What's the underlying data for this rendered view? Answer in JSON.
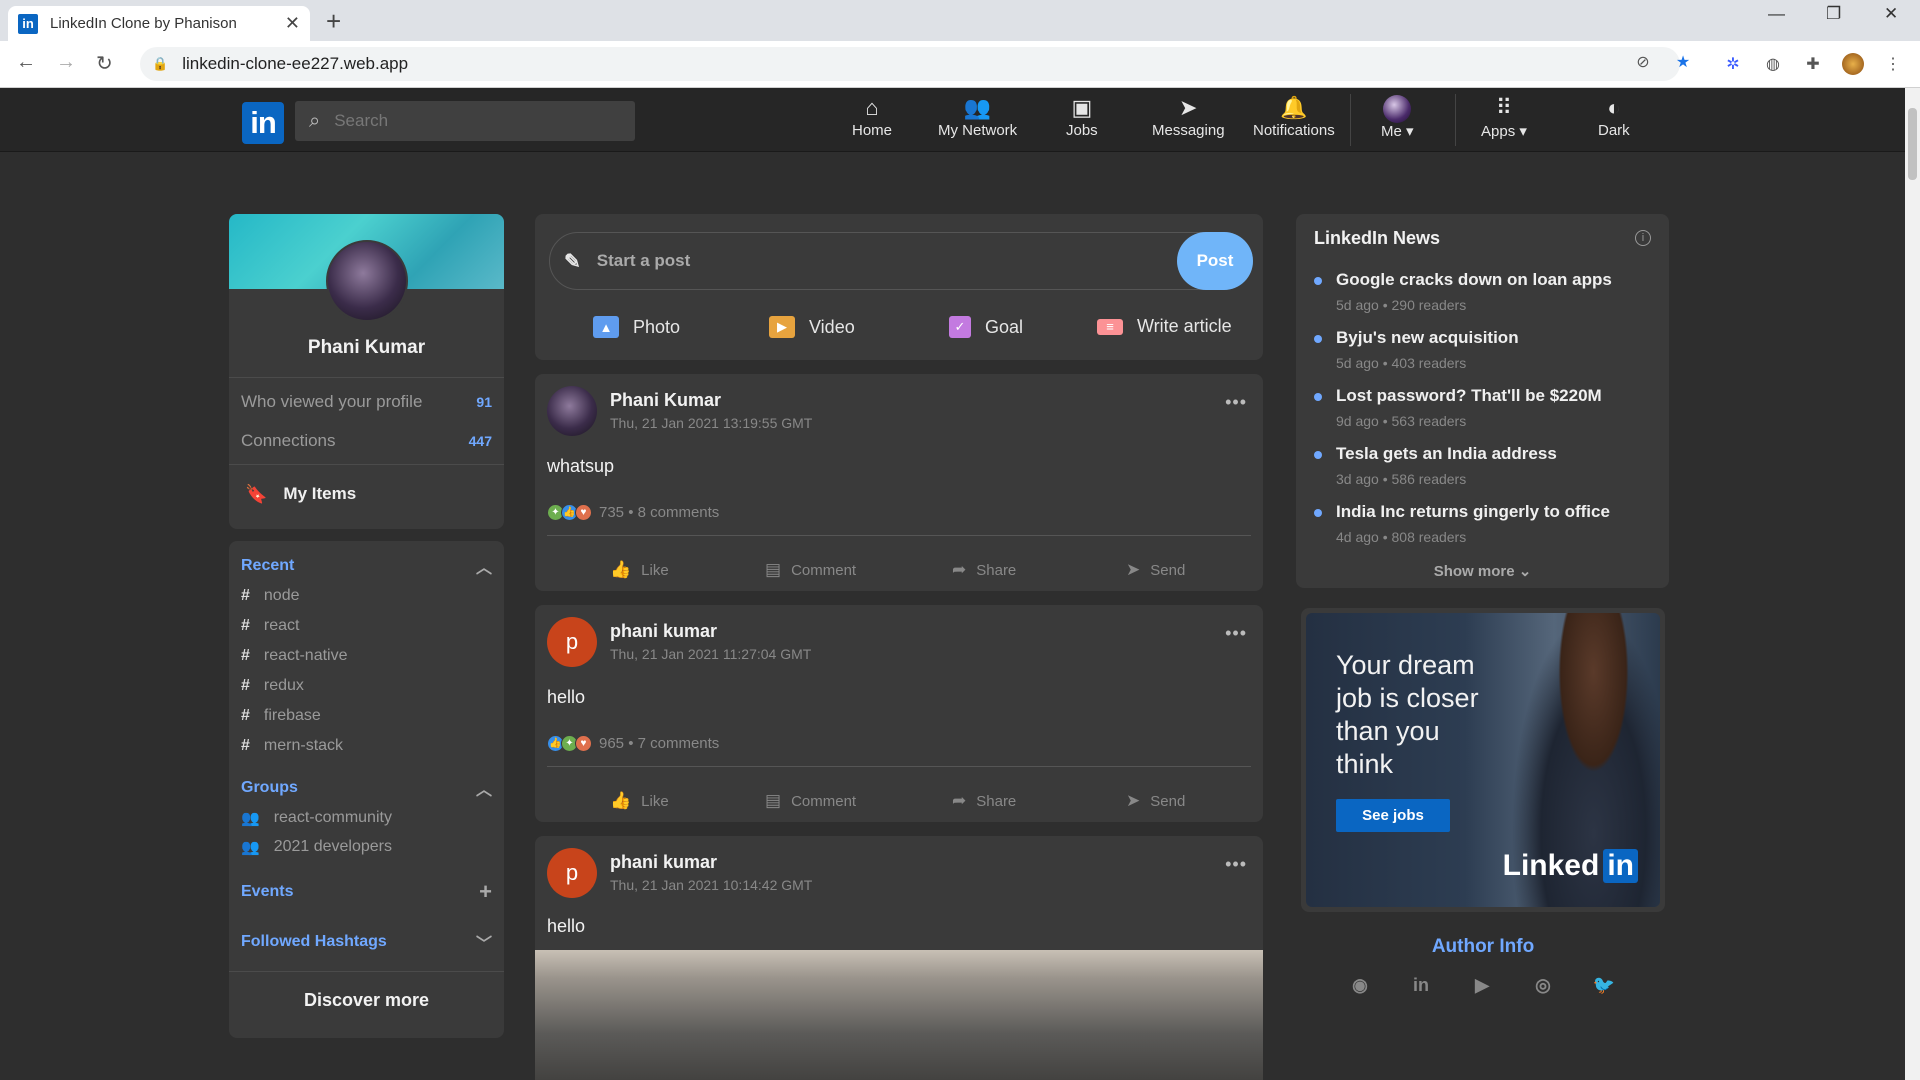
{
  "browser": {
    "tab_title": "LinkedIn Clone by Phanison",
    "tab_close": "✕",
    "new_tab": "+",
    "url": "linkedin-clone-ee227.web.app"
  },
  "header": {
    "logo": "in",
    "search_placeholder": "Search",
    "nav": [
      {
        "label": "Home",
        "icon": "home-icon"
      },
      {
        "label": "My Network",
        "icon": "network-icon"
      },
      {
        "label": "Jobs",
        "icon": "briefcase-icon"
      },
      {
        "label": "Messaging",
        "icon": "send-icon"
      },
      {
        "label": "Notifications",
        "icon": "bell-icon"
      },
      {
        "label": "Me ▾",
        "icon": "avatar"
      },
      {
        "label": "Apps ▾",
        "icon": "grid-icon"
      },
      {
        "label": "Dark",
        "icon": "theme-icon"
      }
    ]
  },
  "profile": {
    "name": "Phani Kumar",
    "viewed_label": "Who viewed your profile",
    "viewed_count": "91",
    "connections_label": "Connections",
    "connections_count": "447",
    "my_items": "My Items"
  },
  "sidebar": {
    "recent_label": "Recent",
    "recent_tags": [
      "node",
      "react",
      "react-native",
      "redux",
      "firebase",
      "mern-stack"
    ],
    "groups_label": "Groups",
    "groups": [
      "react-community",
      "2021 developers"
    ],
    "events_label": "Events",
    "hashtags_label": "Followed Hashtags",
    "discover": "Discover more"
  },
  "composer": {
    "placeholder": "Start a post",
    "post_button": "Post",
    "options": [
      {
        "label": "Photo",
        "color": "#5f9cef"
      },
      {
        "label": "Video",
        "color": "#e7a33e"
      },
      {
        "label": "Goal",
        "color": "#c37ae0"
      },
      {
        "label": "Write article",
        "color": "#fc9295"
      }
    ]
  },
  "posts": [
    {
      "name": "Phani Kumar",
      "date": "Thu, 21 Jan 2021 13:19:55 GMT",
      "body": "whatsup",
      "stats": "735 • 8 comments",
      "avatar_letter": ""
    },
    {
      "name": "phani kumar",
      "date": "Thu, 21 Jan 2021 11:27:04 GMT",
      "body": "hello",
      "stats": "965 • 7 comments",
      "avatar_letter": "p"
    },
    {
      "name": "phani kumar",
      "date": "Thu, 21 Jan 2021 10:14:42 GMT",
      "body": "hello",
      "stats": "",
      "avatar_letter": "p"
    }
  ],
  "post_actions": [
    "Like",
    "Comment",
    "Share",
    "Send"
  ],
  "news": {
    "title": "LinkedIn News",
    "items": [
      {
        "headline": "Google cracks down on loan apps",
        "meta": "5d ago • 290 readers"
      },
      {
        "headline": "Byju's new acquisition",
        "meta": "5d ago • 403 readers"
      },
      {
        "headline": "Lost password? That'll be $220M",
        "meta": "9d ago • 563 readers"
      },
      {
        "headline": "Tesla gets an India address",
        "meta": "3d ago • 586 readers"
      },
      {
        "headline": "India Inc returns gingerly to office",
        "meta": "4d ago • 808 readers"
      }
    ],
    "show_more": "Show more ⌄"
  },
  "ad": {
    "text": "Your dream job is closer than you think",
    "button": "See jobs",
    "logo_text": "Linked",
    "logo_in": "in"
  },
  "author": {
    "title": "Author Info",
    "links": [
      "github-icon",
      "linkedin-icon",
      "youtube-icon",
      "instagram-icon",
      "twitter-icon"
    ]
  },
  "colors": {
    "accent": "#70a8ff",
    "brand": "#0a66c2",
    "background": "#2e2e2e",
    "card": "#3a3a3a"
  }
}
